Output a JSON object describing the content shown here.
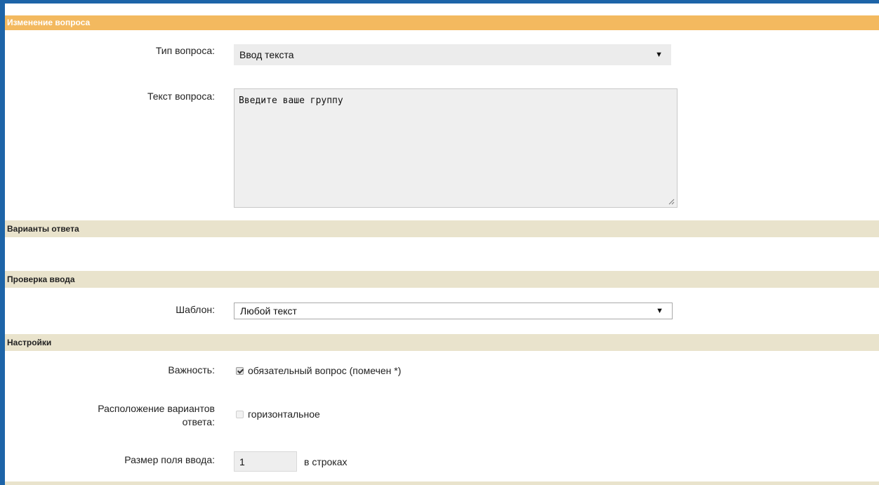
{
  "header": {
    "title": "Изменение вопроса"
  },
  "question_type": {
    "label": "Тип вопроса:",
    "value": "Ввод текста"
  },
  "question_text": {
    "label": "Текст вопроса:",
    "value": "Введите ваше группу"
  },
  "sections": {
    "answers": "Варианты ответа",
    "validation": "Проверка ввода",
    "settings": "Настройки"
  },
  "template": {
    "label": "Шаблон:",
    "value": "Любой текст"
  },
  "importance": {
    "label": "Важность:",
    "option": "обязательный вопрос (помечен *)",
    "checked": true
  },
  "layout": {
    "label_line1": "Расположение вариантов",
    "label_line2": "ответа:",
    "option": "горизонтальное",
    "checked": false
  },
  "field_size": {
    "label": "Размер поля ввода:",
    "value": "1",
    "unit": "в строках"
  },
  "icons": {
    "dropdown": "dropdown-arrow-icon",
    "resize": "resize-grip-icon"
  },
  "colors": {
    "header": "#f3b95f",
    "section": "#e9e3cc",
    "frame": "#1d64a8"
  }
}
